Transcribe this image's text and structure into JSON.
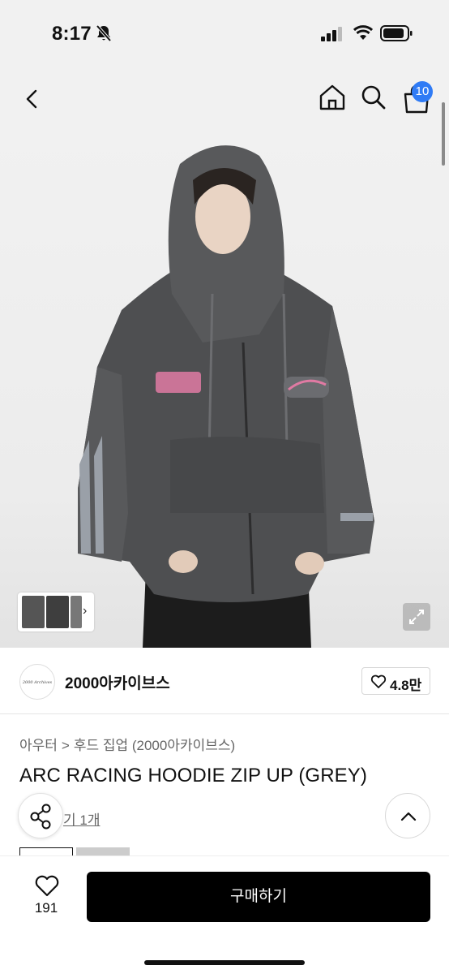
{
  "status_bar": {
    "time": "8:17"
  },
  "header": {
    "cart_count": "10"
  },
  "hero": {
    "thumb_chevron": "›"
  },
  "brand": {
    "name": "2000아카이브스",
    "avatar_text": "2000 Archives",
    "likes": "4.8만"
  },
  "breadcrumb": [
    "아우터",
    ">",
    "후드 집업 (2000아카이브스)"
  ],
  "product": {
    "title": "ARC RACING HOODIE ZIP UP (GREY)",
    "review_link": "기 1개"
  },
  "bottom_bar": {
    "wish_count": "191",
    "buy_label": "구매하기"
  },
  "colors": {
    "badge": "#2f7bf5",
    "buy": "#000000",
    "background": "#f1f1f1"
  },
  "icons": [
    "bell-slash-icon",
    "signal-icon",
    "wifi-icon",
    "battery-icon",
    "back-icon",
    "home-icon",
    "search-icon",
    "cart-icon",
    "expand-icon",
    "heart-icon",
    "share-icon",
    "chevron-up-icon"
  ]
}
